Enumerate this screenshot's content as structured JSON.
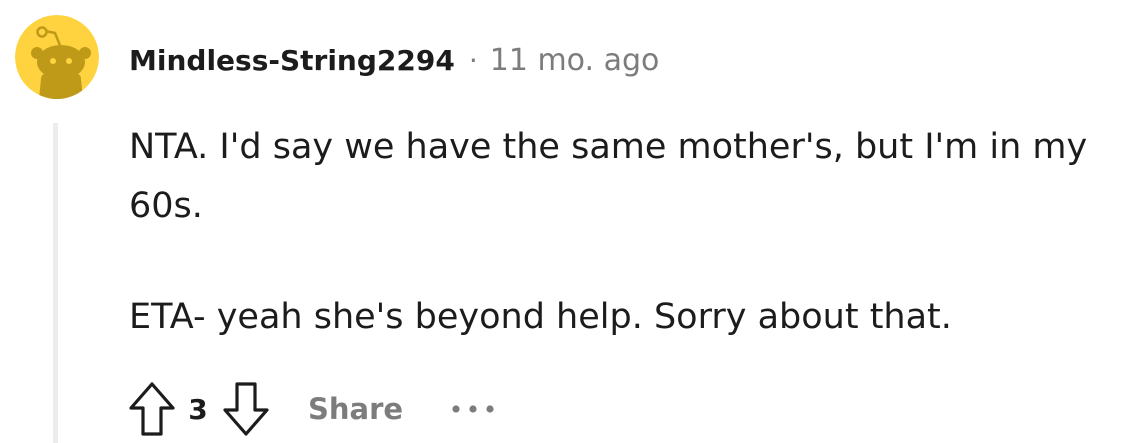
{
  "comment": {
    "author": "Mindless-String2294",
    "separator": "·",
    "timestamp": "11 mo. ago",
    "paragraphs": [
      "NTA. I'd say we have the same mother's, but I'm in my 60s.",
      "ETA- yeah she's beyond help. Sorry about that."
    ],
    "score": "3",
    "share_label": "Share",
    "icons": {
      "avatar": "snoo-avatar-icon",
      "upvote": "arrow-up-outline-icon",
      "downvote": "arrow-down-outline-icon",
      "more": "more-horizontal-icon"
    }
  },
  "colors": {
    "avatar_background": "#FFD23F",
    "avatar_figure": "#BF9A19",
    "text_primary": "#1C1C1C",
    "text_secondary": "#7C7C7C",
    "thread_line": "#ECECEC"
  }
}
